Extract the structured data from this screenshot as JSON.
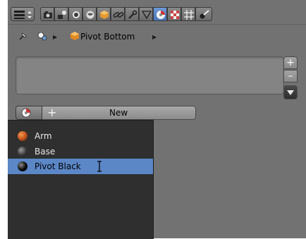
{
  "header": {
    "editor_menu_icon": "editor-type-icon",
    "context_tabs": [
      {
        "name": "render",
        "icon": "camera-icon"
      },
      {
        "name": "render-layers",
        "icon": "render-layers-icon"
      },
      {
        "name": "scene",
        "icon": "scene-icon"
      },
      {
        "name": "world",
        "icon": "world-icon"
      },
      {
        "name": "object",
        "icon": "object-icon"
      },
      {
        "name": "constraints",
        "icon": "link-icon"
      },
      {
        "name": "modifiers",
        "icon": "wrench-icon"
      },
      {
        "name": "data",
        "icon": "mesh-data-icon"
      },
      {
        "name": "material",
        "icon": "material-icon",
        "active": true
      },
      {
        "name": "texture",
        "icon": "texture-icon"
      },
      {
        "name": "particles",
        "icon": "particles-icon"
      },
      {
        "name": "physics",
        "icon": "physics-icon"
      }
    ]
  },
  "breadcrumb": {
    "object_name": "Pivot Bottom"
  },
  "material_slots": {
    "add_slot_symbol": "+",
    "remove_slot_symbol": "–"
  },
  "browse_row": {
    "new_label": "New",
    "plus_symbol": "+"
  },
  "material_menu": {
    "items": [
      {
        "name": "Arm",
        "ball_color": "#c0501a",
        "selected": false
      },
      {
        "name": "Base",
        "ball_color": "#3a3a3a",
        "selected": false
      },
      {
        "name": "Pivot Black",
        "ball_color": "#080808",
        "selected": true
      }
    ]
  },
  "colors": {
    "panel": "#727272",
    "menu_bg": "#2f2f2f",
    "selection": "#5b87c7",
    "active_tab": "#5a84c4"
  }
}
